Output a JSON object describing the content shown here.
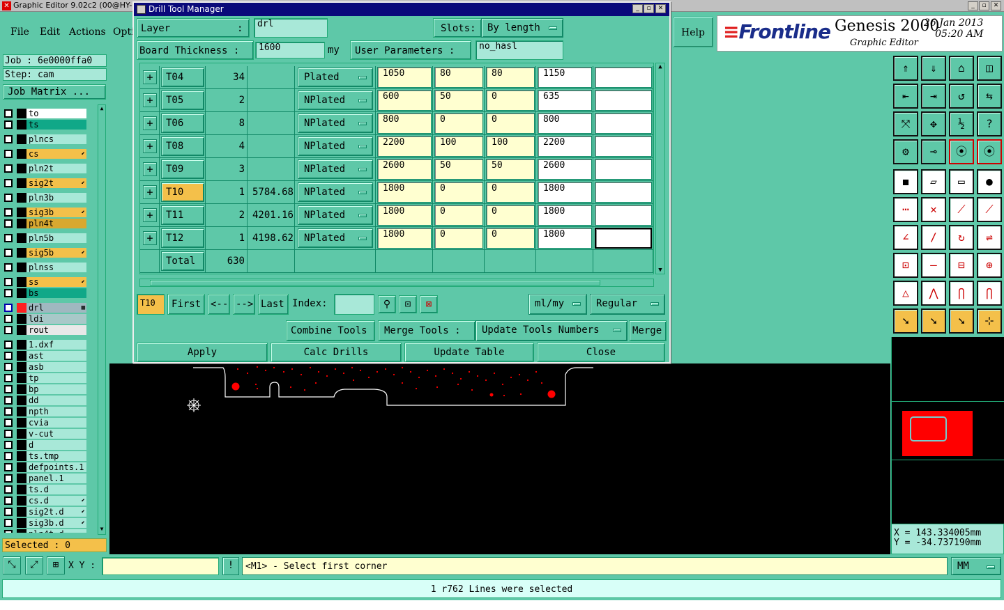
{
  "window": {
    "title": "Graphic Editor 9.02c2 (00@HY-"
  },
  "menu": {
    "file": "File",
    "edit": "Edit",
    "actions": "Actions",
    "options": "Opti",
    "help": "Help"
  },
  "brand": {
    "logo": "Frontline",
    "product": "Genesis 2000",
    "editor": "Graphic Editor",
    "date": "26 Jan 2013",
    "time": "05:20 AM"
  },
  "job": {
    "job": "Job : 6e0000ffa0",
    "step": "Step: cam",
    "matrix": "Job Matrix ..."
  },
  "layers": [
    {
      "name": "to",
      "bg": "#ffffff",
      "sw": "#000000"
    },
    {
      "name": "ts",
      "bg": "#10a888",
      "sw": "#000000"
    },
    {
      "name": "plncs",
      "bg": "#a8e8d8",
      "sw": "#000000"
    },
    {
      "name": "cs",
      "bg": "#f4c04a",
      "sw": "#000000",
      "mark": "⬋"
    },
    {
      "name": "pln2t",
      "bg": "#a8e8d8",
      "sw": "#000000"
    },
    {
      "name": "sig2t",
      "bg": "#f4c04a",
      "sw": "#000000",
      "mark": "⬋"
    },
    {
      "name": "pln3b",
      "bg": "#a8e8d8",
      "sw": "#000000"
    },
    {
      "name": "sig3b",
      "bg": "#f4c04a",
      "sw": "#000000",
      "mark": "⬋"
    },
    {
      "name": "pln4t",
      "bg": "#d8a830",
      "sw": "#000000"
    },
    {
      "name": "pln5b",
      "bg": "#a8e8d8",
      "sw": "#000000"
    },
    {
      "name": "sig5b",
      "bg": "#f4c04a",
      "sw": "#000000",
      "mark": "⬋"
    },
    {
      "name": "plnss",
      "bg": "#a8e8d8",
      "sw": "#000000"
    },
    {
      "name": "ss",
      "bg": "#f4c04a",
      "sw": "#000000",
      "mark": "⬋"
    },
    {
      "name": "bs",
      "bg": "#10a888",
      "sw": "#000000"
    },
    {
      "name": "drl",
      "bg": "#a0b8c0",
      "sw": "#ff2020",
      "mark": "▦"
    },
    {
      "name": "ldi",
      "bg": "#a8c8c8",
      "sw": "#000000"
    },
    {
      "name": "rout",
      "bg": "#e8e8e8",
      "sw": "#000000"
    },
    {
      "name": "1.dxf",
      "bg": "#a8e8d8",
      "sw": "#000000"
    },
    {
      "name": "ast",
      "bg": "#a8e8d8",
      "sw": "#000000"
    },
    {
      "name": "asb",
      "bg": "#a8e8d8",
      "sw": "#000000"
    },
    {
      "name": "tp",
      "bg": "#a8e8d8",
      "sw": "#000000"
    },
    {
      "name": "bp",
      "bg": "#a8e8d8",
      "sw": "#000000"
    },
    {
      "name": "dd",
      "bg": "#a8e8d8",
      "sw": "#000000"
    },
    {
      "name": "npth",
      "bg": "#a8e8d8",
      "sw": "#000000"
    },
    {
      "name": "cvia",
      "bg": "#a8e8d8",
      "sw": "#000000"
    },
    {
      "name": "v-cut",
      "bg": "#a8e8d8",
      "sw": "#000000"
    },
    {
      "name": "d",
      "bg": "#a8e8d8",
      "sw": "#000000"
    },
    {
      "name": "ts.tmp",
      "bg": "#a8e8d8",
      "sw": "#000000"
    },
    {
      "name": "defpoints.1",
      "bg": "#a8e8d8",
      "sw": "#000000"
    },
    {
      "name": "panel.1",
      "bg": "#a8e8d8",
      "sw": "#000000"
    },
    {
      "name": "ts.d",
      "bg": "#a8e8d8",
      "sw": "#000000"
    },
    {
      "name": "cs.d",
      "bg": "#a8e8d8",
      "sw": "#000000",
      "mark": "⬋"
    },
    {
      "name": "sig2t.d",
      "bg": "#a8e8d8",
      "sw": "#000000",
      "mark": "⬋"
    },
    {
      "name": "sig3b.d",
      "bg": "#a8e8d8",
      "sw": "#000000",
      "mark": "⬋"
    },
    {
      "name": "pln4t.d",
      "bg": "#a8e8d8",
      "sw": "#000000"
    }
  ],
  "selected": "Selected : 0",
  "dialog": {
    "title": "Drill Tool Manager",
    "layer_label": "Layer",
    "layer_colon": ":",
    "layer_value": "drl",
    "slots_label": "Slots:",
    "slots_value": "By length",
    "thickness_label": "Board Thickness :",
    "thickness_value": "1600",
    "thickness_unit": "my",
    "user_params_label": "User Parameters :",
    "user_params_value": "no_hasl",
    "tools": [
      {
        "tool": "T04",
        "count": "34",
        "slot": "",
        "type": "Plated",
        "a": "1050",
        "b": "80",
        "c": "80",
        "d": "1150",
        "e": "",
        "hl": false
      },
      {
        "tool": "T05",
        "count": "2",
        "slot": "",
        "type": "NPlated",
        "a": "600",
        "b": "50",
        "c": "0",
        "d": "635",
        "e": "",
        "hl": false
      },
      {
        "tool": "T06",
        "count": "8",
        "slot": "",
        "type": "NPlated",
        "a": "800",
        "b": "0",
        "c": "0",
        "d": "800",
        "e": "",
        "hl": false
      },
      {
        "tool": "T08",
        "count": "4",
        "slot": "",
        "type": "NPlated",
        "a": "2200",
        "b": "100",
        "c": "100",
        "d": "2200",
        "e": "",
        "hl": false
      },
      {
        "tool": "T09",
        "count": "3",
        "slot": "",
        "type": "NPlated",
        "a": "2600",
        "b": "50",
        "c": "50",
        "d": "2600",
        "e": "",
        "hl": false
      },
      {
        "tool": "T10",
        "count": "1",
        "slot": "5784.68",
        "type": "NPlated",
        "a": "1800",
        "b": "0",
        "c": "0",
        "d": "1800",
        "e": "",
        "hl": true
      },
      {
        "tool": "T11",
        "count": "2",
        "slot": "4201.16",
        "type": "NPlated",
        "a": "1800",
        "b": "0",
        "c": "0",
        "d": "1800",
        "e": "",
        "hl": false
      },
      {
        "tool": "T12",
        "count": "1",
        "slot": "4198.62",
        "type": "NPlated",
        "a": "1800",
        "b": "0",
        "c": "0",
        "d": "1800",
        "e": "",
        "hl": false
      }
    ],
    "total_label": "Total",
    "total_value": "630",
    "current_tool": "T10",
    "nav": {
      "first": "First",
      "prev": "<--",
      "next": "-->",
      "last": "Last",
      "index": "Index:"
    },
    "unit_select": "ml/my",
    "mode_select": "Regular",
    "combine": "Combine Tools",
    "merge_tools": "Merge Tools :",
    "update_numbers": "Update Tools Numbers",
    "merge": "Merge",
    "apply": "Apply",
    "calc": "Calc Drills",
    "update_table": "Update Table",
    "close": "Close"
  },
  "coords": {
    "x": "X = 143.334005mm",
    "y": "Y = -34.737190mm"
  },
  "bottom": {
    "xy_label": "X Y :",
    "prompt": "<M1> - Select first corner",
    "units": "MM"
  },
  "status": "1 r762 Lines were selected",
  "colors": {
    "teal": "#5ec8a8",
    "orange": "#f4c04a",
    "navy": "#0a0a7a",
    "red": "#ff0000"
  }
}
